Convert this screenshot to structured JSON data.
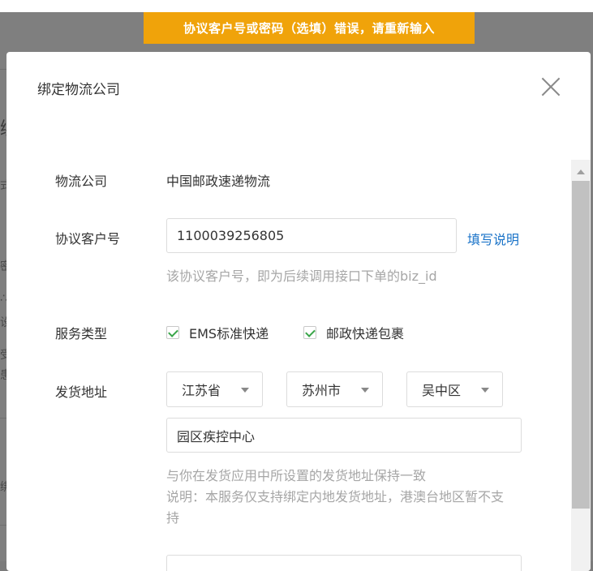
{
  "toast": {
    "message": "协议客户号或密码（选填）错误，请重新输入"
  },
  "background": {
    "glyphs": [
      "绑",
      "式",
      "密",
      "∴",
      "设",
      "受",
      "患",
      "绑"
    ]
  },
  "modal": {
    "title": "绑定物流公司",
    "company": {
      "label": "物流公司",
      "value": "中国邮政速递物流"
    },
    "customer_no": {
      "label": "协议客户号",
      "value": "1100039256805",
      "help_link": "填写说明",
      "hint": "该协议客户号，即为后续调用接口下单的biz_id"
    },
    "service": {
      "label": "服务类型",
      "options": [
        {
          "label": "EMS标准快递",
          "checked": true
        },
        {
          "label": "邮政快递包裹",
          "checked": true
        }
      ]
    },
    "address": {
      "label": "发货地址",
      "province": "江苏省",
      "city": "苏州市",
      "district": "吴中区",
      "detail": "园区疾控中心",
      "hint1": "与你在发货应用中所设置的发货地址保持一致",
      "hint2": "说明：本服务仅支持绑定内地发货地址，港澳台地区暂不支",
      "hint3": "持"
    }
  },
  "colors": {
    "accent_toast": "#f0a30a",
    "link": "#1a73c8",
    "check": "#3aa54a"
  }
}
